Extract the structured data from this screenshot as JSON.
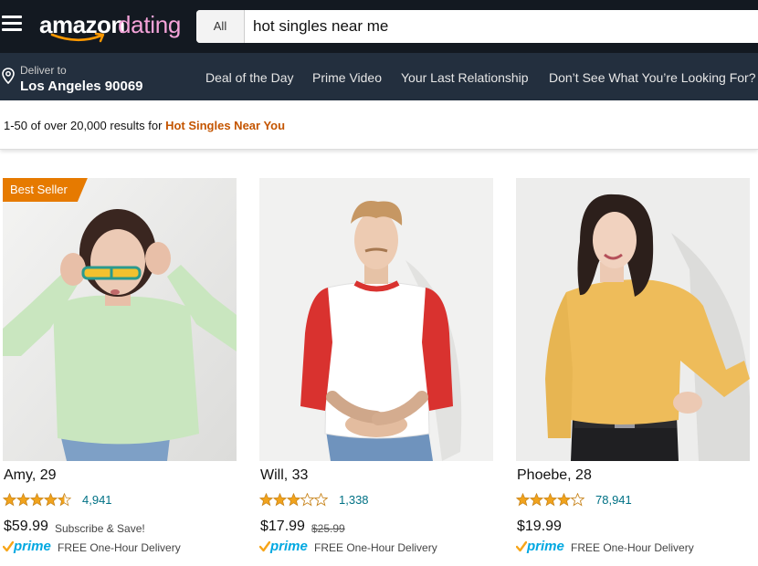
{
  "header": {
    "logo_main": "amazon",
    "logo_sub": "dating",
    "search_category": "All",
    "search_value": "hot singles near me"
  },
  "nav": {
    "deliver_to_label": "Deliver to",
    "deliver_location": "Los Angeles 90069",
    "links": [
      "Deal of the Day",
      "Prime Video",
      "Your Last Relationship",
      "Don’t See What You’re Looking For?"
    ]
  },
  "results": {
    "prefix": "1-50 of over 20,000 results for",
    "query": "Hot Singles Near You"
  },
  "products": [
    {
      "badge": "Best Seller",
      "name": "Amy, 29",
      "rating": 4.5,
      "rating_count": "4,941",
      "price": "$59.99",
      "price_note": "Subscribe & Save!",
      "prime": "prime",
      "delivery": "FREE One-Hour Delivery"
    },
    {
      "name": "Will, 33",
      "rating": 3,
      "rating_count": "1,338",
      "price": "$17.99",
      "price_old": "$25.99",
      "prime": "prime",
      "delivery": "FREE One-Hour Delivery"
    },
    {
      "name": "Phoebe, 28",
      "rating": 4,
      "rating_count": "78,941",
      "price": "$19.99",
      "prime": "prime",
      "delivery": "FREE One-Hour Delivery"
    }
  ],
  "colors": {
    "topbar": "#131921",
    "navbar": "#232f3e",
    "accent": "#e67a00",
    "link": "#007185",
    "star": "#f1a31c",
    "prime": "#00a8e1"
  }
}
